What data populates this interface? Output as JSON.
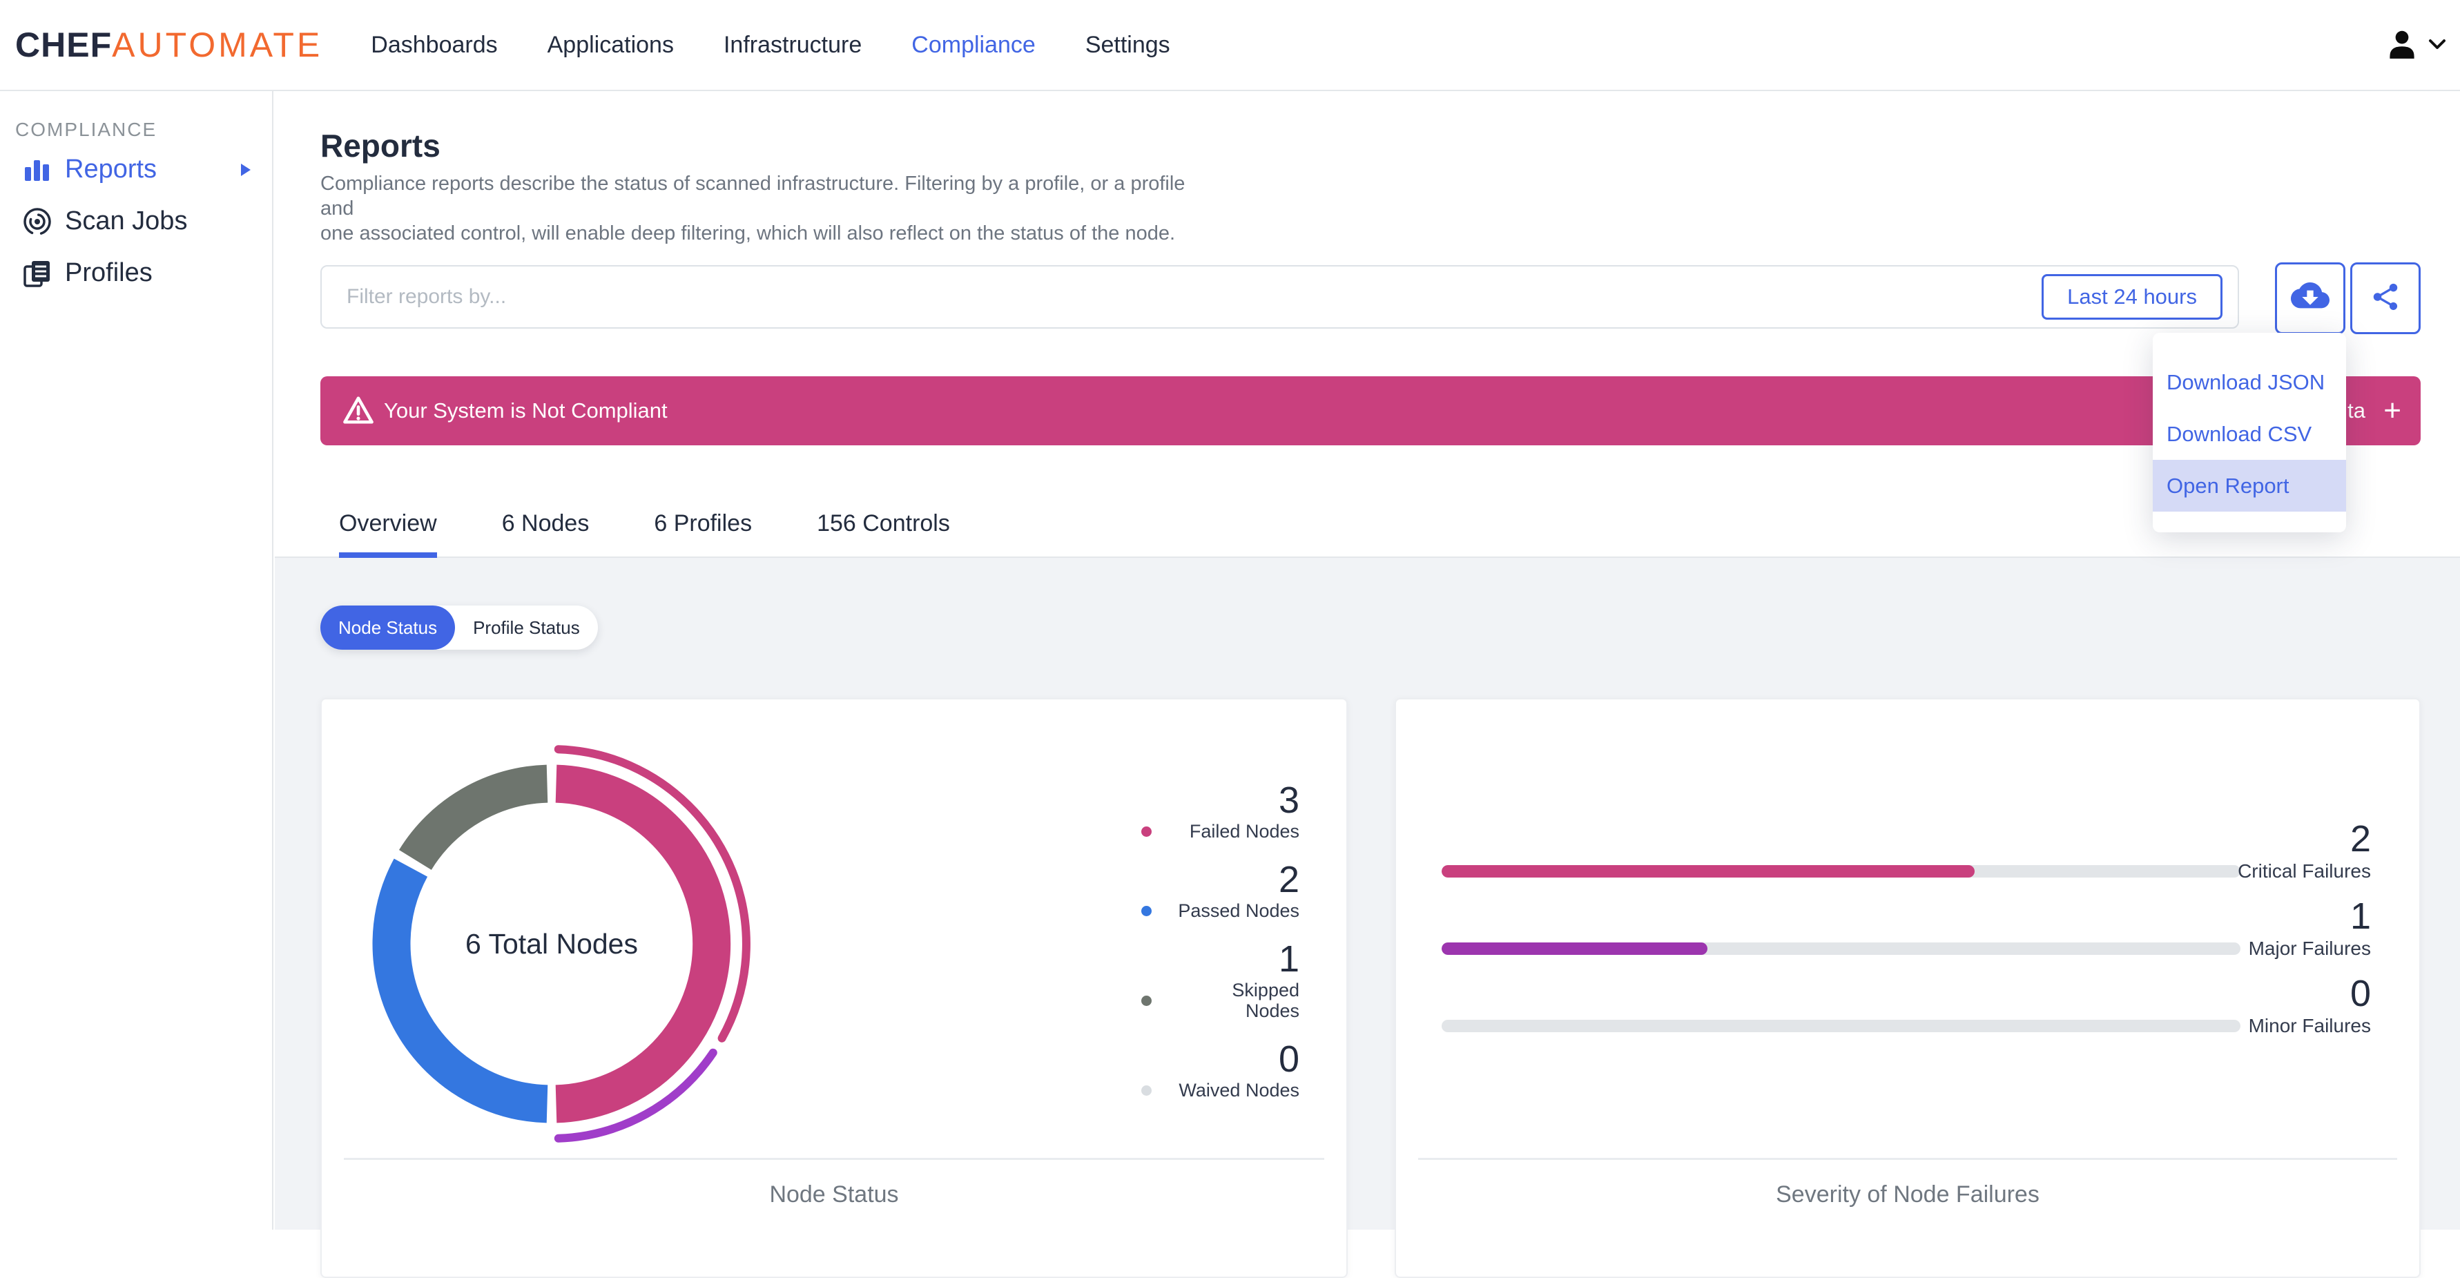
{
  "header": {
    "logo": {
      "part1": "CHEF",
      "part2": "AUTOMATE"
    },
    "nav": [
      {
        "label": "Dashboards"
      },
      {
        "label": "Applications"
      },
      {
        "label": "Infrastructure"
      },
      {
        "label": "Compliance",
        "active": true
      },
      {
        "label": "Settings"
      }
    ]
  },
  "sidebar": {
    "section_label": "COMPLIANCE",
    "items": [
      {
        "label": "Reports",
        "icon": "bar-chart-icon",
        "active": true
      },
      {
        "label": "Scan Jobs",
        "icon": "radar-icon"
      },
      {
        "label": "Profiles",
        "icon": "documents-icon"
      }
    ]
  },
  "page": {
    "title": "Reports",
    "description": "Compliance reports describe the status of scanned infrastructure. Filtering by a profile, or a profile and\none associated control, will enable deep filtering, which will also reflect on the status of the node."
  },
  "filter_bar": {
    "placeholder": "Filter reports by...",
    "time_range_label": "Last 24 hours"
  },
  "download_menu": {
    "items": [
      {
        "label": "Download JSON"
      },
      {
        "label": "Download CSV"
      },
      {
        "label": "Open Report",
        "highlighted": true
      }
    ]
  },
  "banner": {
    "text": "Your System is Not Compliant",
    "partial_right_text": "ta",
    "add_symbol": "+"
  },
  "tabs": [
    {
      "label": "Overview",
      "active": true
    },
    {
      "label": "6 Nodes"
    },
    {
      "label": "6 Profiles"
    },
    {
      "label": "156 Controls"
    }
  ],
  "status_toggle": {
    "options": [
      {
        "label": "Node Status",
        "active": true
      },
      {
        "label": "Profile Status"
      }
    ]
  },
  "chart_data": [
    {
      "type": "pie",
      "subtype": "donut",
      "title": "Node Status",
      "center_label": "6 Total Nodes",
      "total": 6,
      "legend_position": "right",
      "slices": [
        {
          "label": "Failed Nodes",
          "value": 3,
          "color": "#c9407e"
        },
        {
          "label": "Passed Nodes",
          "value": 2,
          "color": "#3477e0"
        },
        {
          "label": "Skipped Nodes",
          "value": 1,
          "color": "#6e756e"
        },
        {
          "label": "Waived Nodes",
          "value": 0,
          "color": "#d9dde1"
        }
      ],
      "outer_arcs": [
        {
          "from_deg": 2,
          "to_deg": 119,
          "color": "#c9407e"
        },
        {
          "from_deg": 124,
          "to_deg": 178,
          "color": "#a03dc9"
        }
      ]
    },
    {
      "type": "bar",
      "orientation": "horizontal",
      "title": "Severity of Node Failures",
      "max": 3,
      "track_color": "#e2e5e8",
      "bars": [
        {
          "label": "Critical Failures",
          "value": 2,
          "color": "#c9407e"
        },
        {
          "label": "Major Failures",
          "value": 1,
          "color": "#9c35ae"
        },
        {
          "label": "Minor Failures",
          "value": 0,
          "color": "#e2e5e8"
        }
      ]
    }
  ],
  "colors": {
    "primary_blue": "#4165e4",
    "banner_pink": "#c9407e",
    "logo_orange": "#f2692f",
    "text_dark": "#232c3e",
    "menu_highlight": "#d5daf6"
  }
}
